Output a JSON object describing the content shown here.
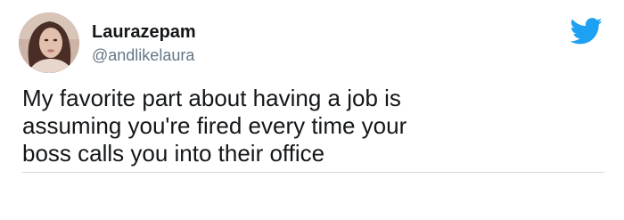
{
  "tweet": {
    "author": {
      "display_name": "Laurazepam",
      "handle": "@andlikelaura",
      "avatar_icon": "profile-photo"
    },
    "platform_icon": "twitter-bird-icon",
    "text_lines": [
      "My favorite part about having a job is",
      "assuming you're fired every time your",
      "boss calls you into their office"
    ]
  },
  "colors": {
    "twitter_blue": "#1da1f2",
    "text_primary": "#14171a",
    "text_secondary": "#657786",
    "divider": "#d6dbe0"
  }
}
